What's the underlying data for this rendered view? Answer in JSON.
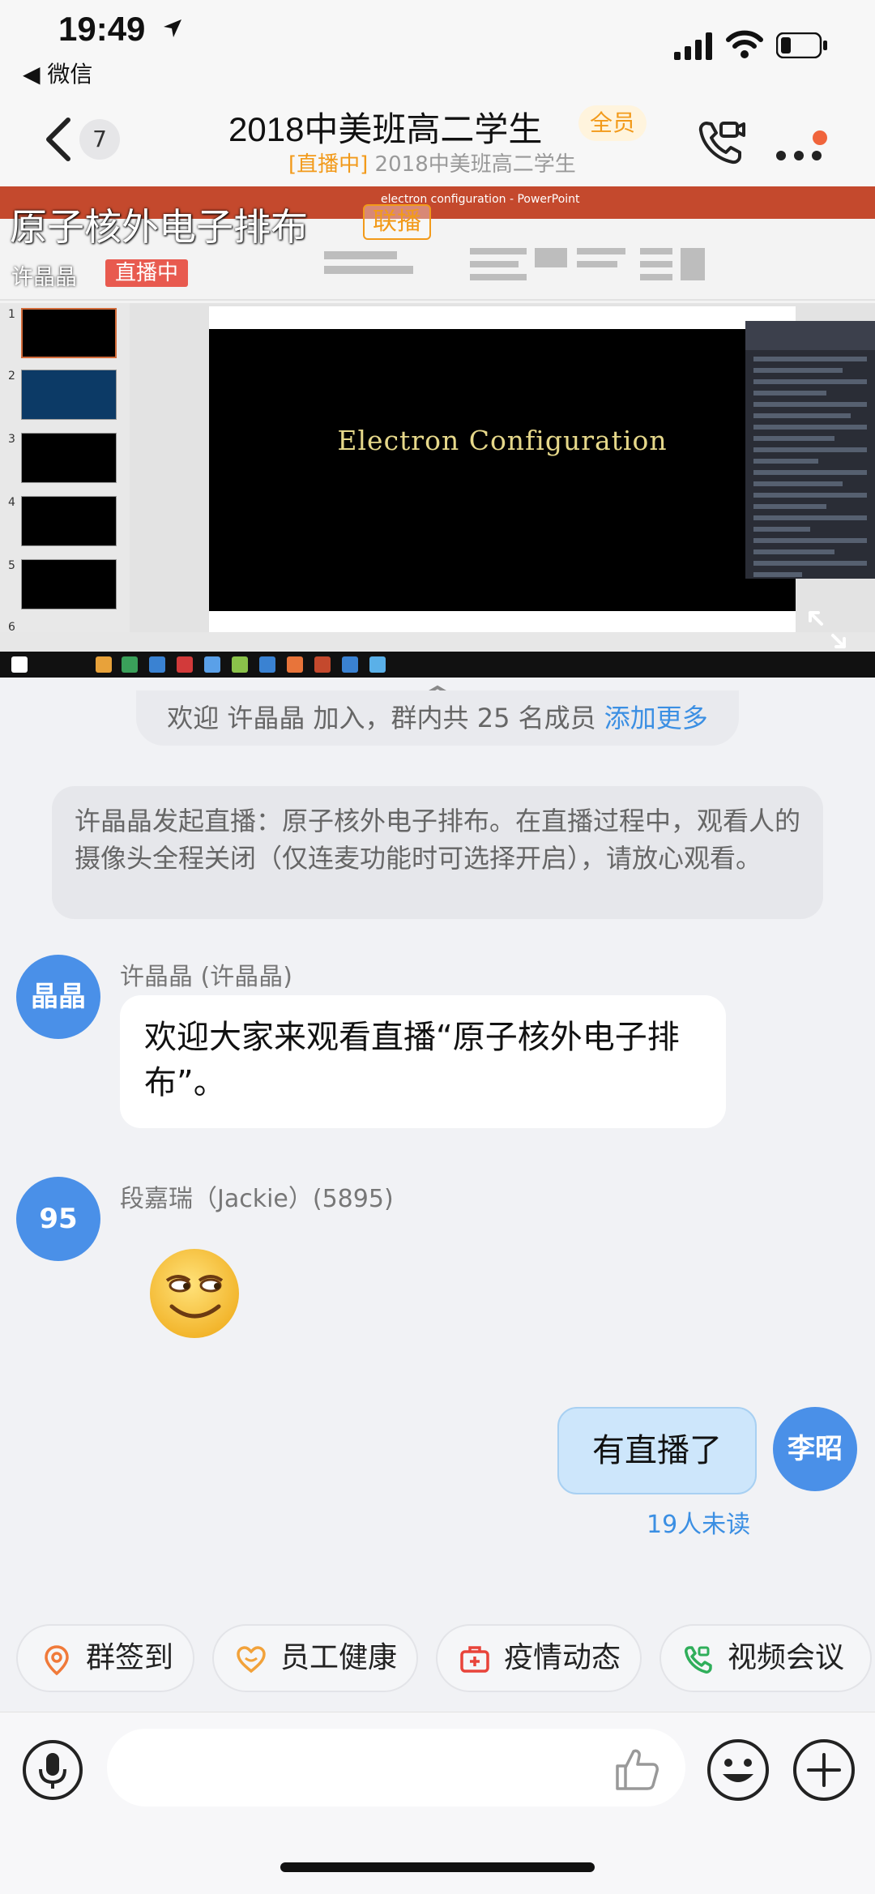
{
  "status_bar": {
    "time": "19:49",
    "back_app": "◀ 微信"
  },
  "header": {
    "unread": "7",
    "title": "2018中美班高二学生",
    "tag": "全员",
    "subtitle_live": "[直播中]",
    "subtitle_name": " 2018中美班高二学生"
  },
  "video": {
    "overlay_title": "原子核外电子排布",
    "overlay_tag": "联播",
    "host": "许晶晶",
    "live_badge": "直播中",
    "ppt_window_title": "electron configuration - PowerPoint",
    "slide_title": "Electron Configuration"
  },
  "chat": {
    "join_text": "欢迎 许晶晶 加入，群内共 25 名成员 ",
    "join_link": "添加更多",
    "notice": "许晶晶发起直播：原子核外电子排布。在直播过程中，观看人的摄像头全程关闭（仅连麦功能时可选择开启），请放心观看。",
    "messages": [
      {
        "avatar": "晶晶",
        "sender": "许晶晶 (许晶晶)",
        "text": "欢迎大家来观看直播“原子核外电子排布”。"
      },
      {
        "avatar": "95",
        "sender": "段嘉瑞（Jackie）(5895)",
        "emoji": "smirk-emoji"
      },
      {
        "avatar": "李昭",
        "text": "有直播了",
        "unread": "19人未读"
      }
    ]
  },
  "quick_actions": [
    {
      "label": "群签到",
      "icon": "location-pin-icon",
      "color": "#f07a3a"
    },
    {
      "label": "员工健康",
      "icon": "heart-icon",
      "color": "#f2a23a"
    },
    {
      "label": "疫情动态",
      "icon": "medical-kit-icon",
      "color": "#e8443a"
    },
    {
      "label": "视频会议",
      "icon": "video-call-icon",
      "color": "#2fae5a"
    }
  ],
  "colors": {
    "accent_blue": "#3b8fe3",
    "live_orange": "#f29a1a",
    "avatar_blue": "#4a90e8"
  }
}
